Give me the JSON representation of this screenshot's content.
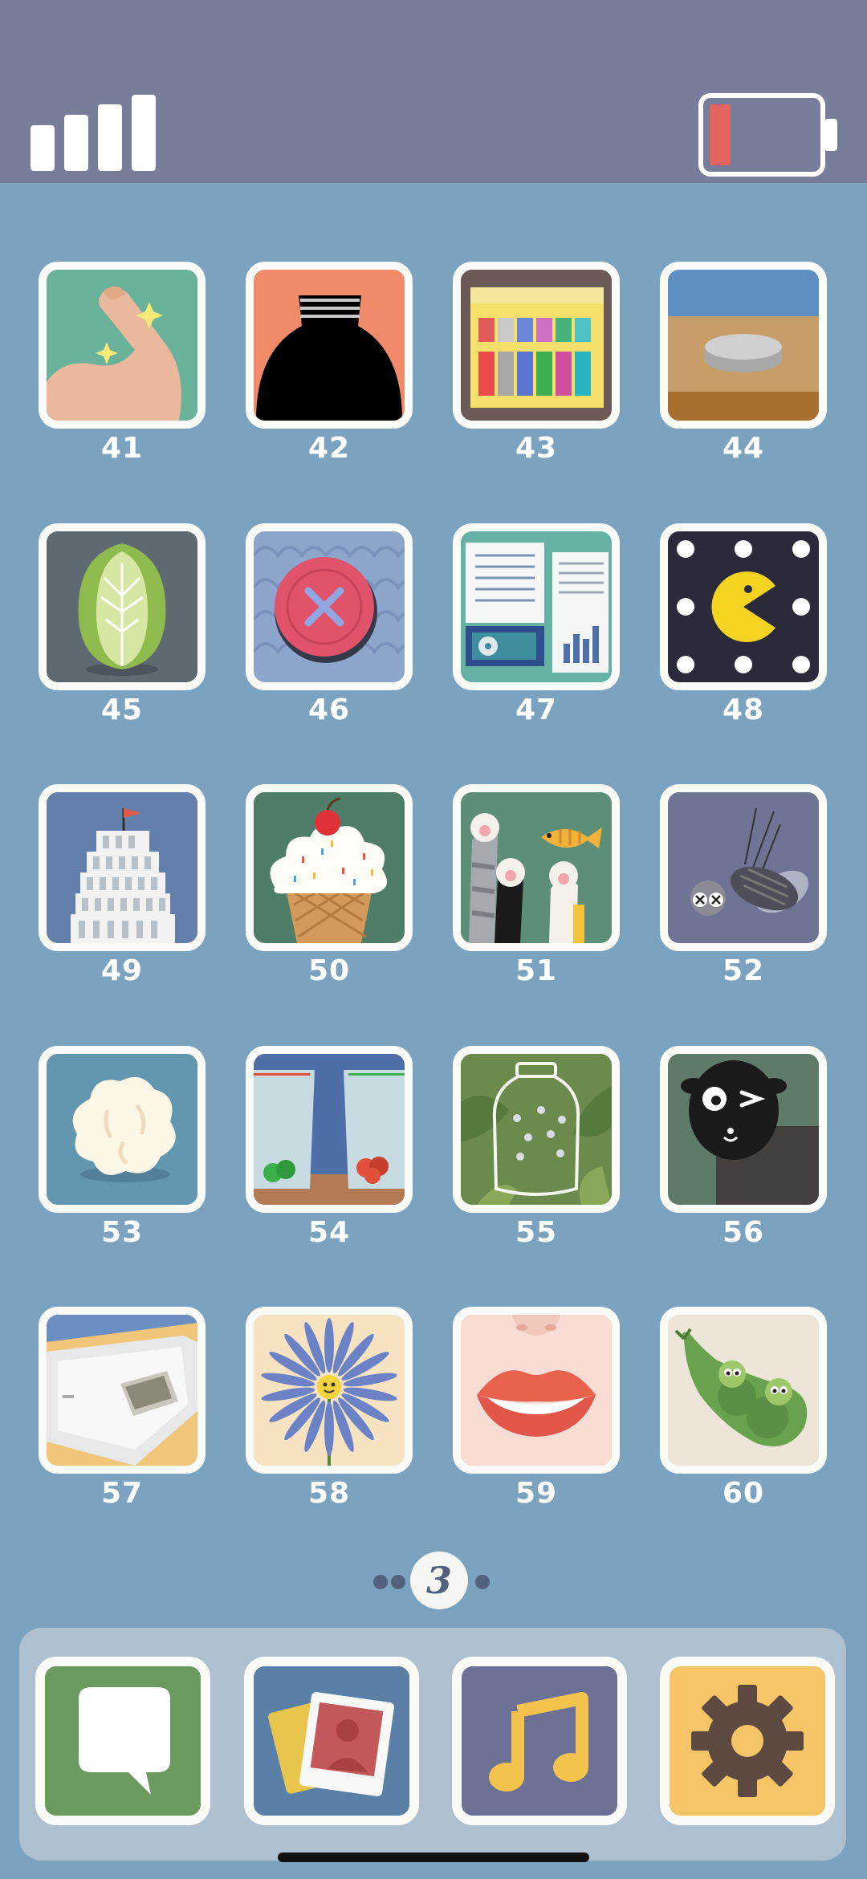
{
  "levels": [
    {
      "number": "41",
      "icon": "flexed-arm-icon"
    },
    {
      "number": "42",
      "icon": "bottle-icon"
    },
    {
      "number": "43",
      "icon": "crayon-box-icon"
    },
    {
      "number": "44",
      "icon": "coin-on-table-icon"
    },
    {
      "number": "45",
      "icon": "cabbage-icon"
    },
    {
      "number": "46",
      "icon": "button-icon"
    },
    {
      "number": "47",
      "icon": "desk-papers-icon"
    },
    {
      "number": "48",
      "icon": "pacman-icon"
    },
    {
      "number": "49",
      "icon": "leaning-tower-icon"
    },
    {
      "number": "50",
      "icon": "ice-cream-icon"
    },
    {
      "number": "51",
      "icon": "cat-paws-fish-icon"
    },
    {
      "number": "52",
      "icon": "dead-fly-icon"
    },
    {
      "number": "53",
      "icon": "popcorn-icon"
    },
    {
      "number": "54",
      "icon": "water-glasses-icon"
    },
    {
      "number": "55",
      "icon": "jar-of-flies-icon"
    },
    {
      "number": "56",
      "icon": "sheep-icon"
    },
    {
      "number": "57",
      "icon": "phone-in-tray-icon"
    },
    {
      "number": "58",
      "icon": "flower-icon"
    },
    {
      "number": "59",
      "icon": "lips-icon"
    },
    {
      "number": "60",
      "icon": "peas-in-pod-icon"
    }
  ],
  "pager": {
    "current": "3",
    "dots_before": 2,
    "dots_after": 1
  },
  "dock": [
    {
      "name": "messages",
      "icon": "speech-bubble-icon"
    },
    {
      "name": "photos",
      "icon": "photo-icon"
    },
    {
      "name": "music",
      "icon": "music-note-icon"
    },
    {
      "name": "settings",
      "icon": "gear-icon"
    }
  ],
  "colors": {
    "status_bar": "#787e9a",
    "background": "#7ba3bf",
    "battery_level": "#e5645e",
    "dock": "#aebfcf"
  },
  "battery": {
    "level": 0.1
  }
}
